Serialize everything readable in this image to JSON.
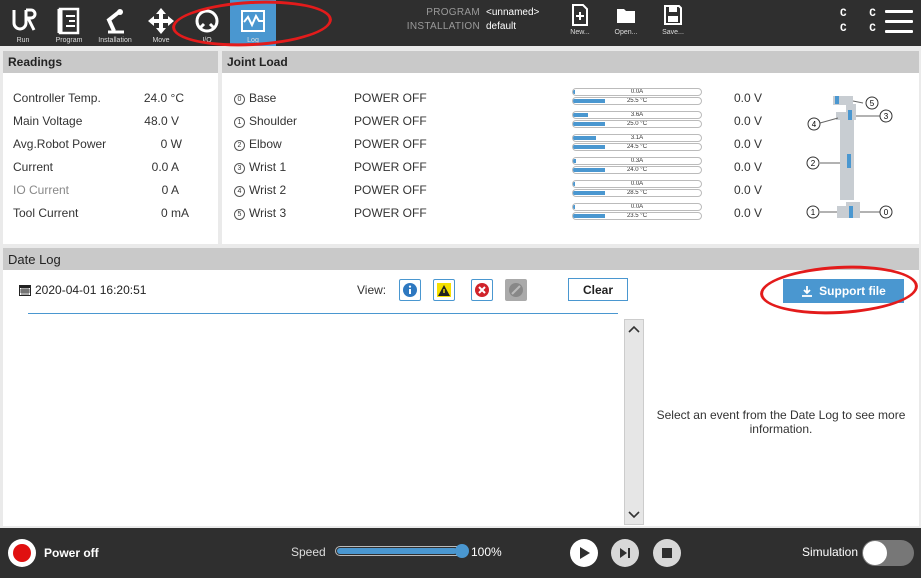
{
  "topbar": {
    "tabs": [
      {
        "label": "Run",
        "icon": "ur-logo-icon"
      },
      {
        "label": "Program",
        "icon": "program-icon"
      },
      {
        "label": "Installation",
        "icon": "installation-icon"
      },
      {
        "label": "Move",
        "icon": "move-icon"
      },
      {
        "label": "I/O",
        "icon": "io-icon"
      },
      {
        "label": "Log",
        "icon": "log-icon",
        "active": true
      }
    ],
    "program_key": "PROGRAM",
    "program_value": "<unnamed>",
    "installation_key": "INSTALLATION",
    "installation_value": "default",
    "file_buttons": [
      {
        "label": "New...",
        "icon": "new-file-icon"
      },
      {
        "label": "Open...",
        "icon": "folder-icon"
      },
      {
        "label": "Save...",
        "icon": "save-icon"
      }
    ],
    "cc_row1": "C C",
    "cc_row2": "C C"
  },
  "readings": {
    "title": "Readings",
    "rows": [
      {
        "label": "Controller Temp.",
        "value": "24.0 °C"
      },
      {
        "label": "Main Voltage",
        "value": "48.0 V"
      },
      {
        "label": "Avg.Robot Power",
        "value": "0 W"
      },
      {
        "label": "Current",
        "value": "0.0 A"
      },
      {
        "label": "IO Current",
        "value": "0 A"
      },
      {
        "label": "Tool Current",
        "value": "0 mA"
      }
    ]
  },
  "joint_load": {
    "title": "Joint Load",
    "joints": [
      {
        "num": "0",
        "name": "Base",
        "status": "POWER OFF",
        "current": "0.0A",
        "current_frac": 0.0,
        "temp": "25.5 °C",
        "temp_frac": 0.25,
        "voltage": "0.0 V"
      },
      {
        "num": "1",
        "name": "Shoulder",
        "status": "POWER OFF",
        "current": "3.6A",
        "current_frac": 0.12,
        "temp": "25.0 °C",
        "temp_frac": 0.25,
        "voltage": "0.0 V"
      },
      {
        "num": "2",
        "name": "Elbow",
        "status": "POWER OFF",
        "current": "3.1A",
        "current_frac": 0.18,
        "temp": "24.5 °C",
        "temp_frac": 0.25,
        "voltage": "0.0 V"
      },
      {
        "num": "3",
        "name": "Wrist 1",
        "status": "POWER OFF",
        "current": "0.3A",
        "current_frac": 0.02,
        "temp": "24.0 °C",
        "temp_frac": 0.25,
        "voltage": "0.0 V"
      },
      {
        "num": "4",
        "name": "Wrist 2",
        "status": "POWER OFF",
        "current": "0.0A",
        "current_frac": 0.0,
        "temp": "28.5 °C",
        "temp_frac": 0.25,
        "voltage": "0.0 V"
      },
      {
        "num": "5",
        "name": "Wrist 3",
        "status": "POWER OFF",
        "current": "0.0A",
        "current_frac": 0.0,
        "temp": "23.5 °C",
        "temp_frac": 0.25,
        "voltage": "0.0 V"
      }
    ],
    "diagram_labels": [
      "5",
      "4",
      "3",
      "2",
      "1",
      "0"
    ]
  },
  "date_log": {
    "title": "Date Log",
    "date": "2020-04-01 16:20:51",
    "view_label": "View:",
    "view_filters": [
      "info-filter-icon",
      "warning-filter-icon",
      "error-filter-icon",
      "disabled-filter-icon"
    ],
    "clear_label": "Clear",
    "support_label": "Support file",
    "detail_text": "Select an event from the Date Log to see more information."
  },
  "bottombar": {
    "power_label": "Power off",
    "speed_label": "Speed",
    "speed_value": "100%",
    "speed_fraction": 1.0,
    "simulation_label": "Simulation"
  },
  "colors": {
    "accent": "#4a97d0",
    "topbar": "#2f2f2f",
    "annotation_red": "#e31b1b",
    "power_red": "#e01010"
  }
}
